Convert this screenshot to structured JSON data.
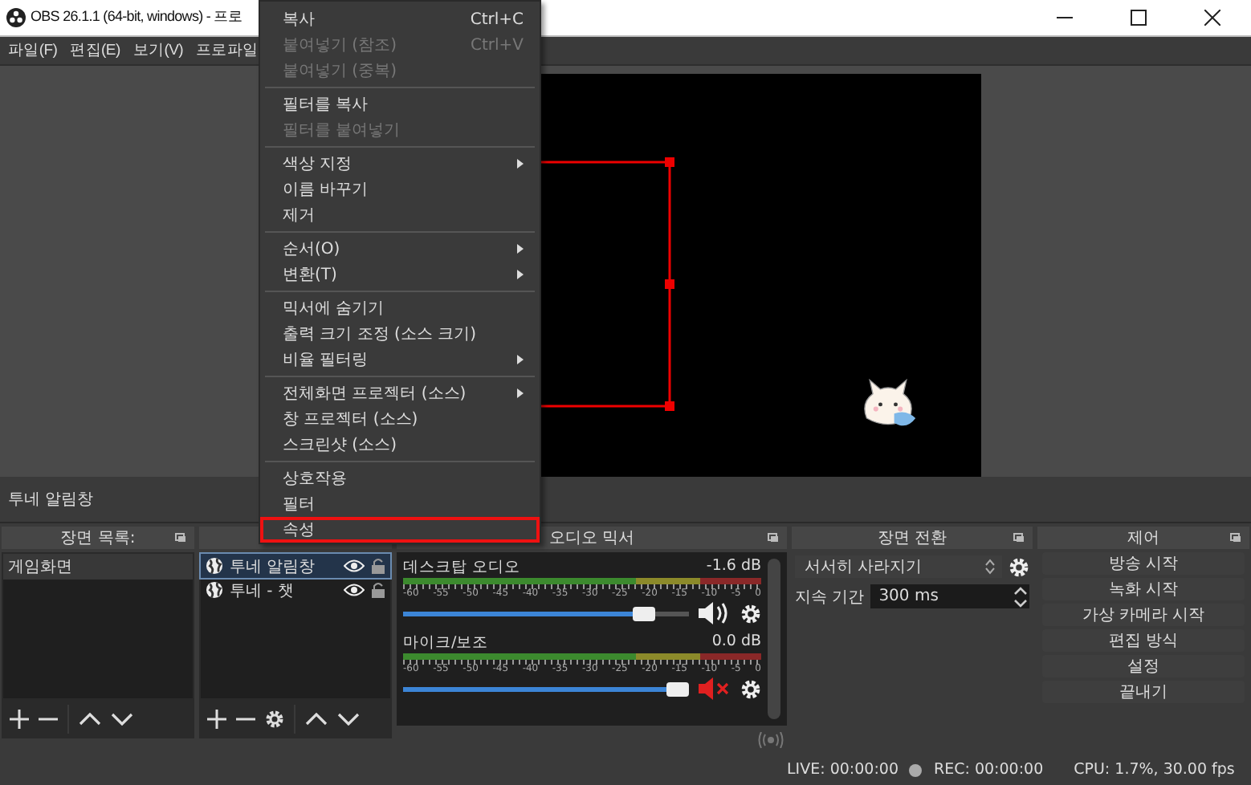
{
  "window": {
    "title": "OBS 26.1.1 (64-bit, windows) - 프로"
  },
  "menu_bar": [
    "파일(F)",
    "편집(E)",
    "보기(V)",
    "프로파일"
  ],
  "context_menu": [
    {
      "kind": "item",
      "label": "복사",
      "shortcut": "Ctrl+C",
      "disabled": false,
      "submenu": false,
      "highlighted": false
    },
    {
      "kind": "item",
      "label": "붙여넣기 (참조)",
      "shortcut": "Ctrl+V",
      "disabled": true,
      "submenu": false,
      "highlighted": false
    },
    {
      "kind": "item",
      "label": "붙여넣기 (중복)",
      "disabled": true,
      "submenu": false,
      "highlighted": false
    },
    {
      "kind": "separator"
    },
    {
      "kind": "item",
      "label": "필터를 복사",
      "disabled": false,
      "submenu": false,
      "highlighted": false
    },
    {
      "kind": "item",
      "label": "필터를 붙여넣기",
      "disabled": true,
      "submenu": false,
      "highlighted": false
    },
    {
      "kind": "separator"
    },
    {
      "kind": "item",
      "label": "색상 지정",
      "disabled": false,
      "submenu": true,
      "highlighted": false
    },
    {
      "kind": "item",
      "label": "이름 바꾸기",
      "disabled": false,
      "submenu": false,
      "highlighted": false
    },
    {
      "kind": "item",
      "label": "제거",
      "disabled": false,
      "submenu": false,
      "highlighted": false
    },
    {
      "kind": "separator"
    },
    {
      "kind": "item",
      "label": "순서(O)",
      "disabled": false,
      "submenu": true,
      "highlighted": false
    },
    {
      "kind": "item",
      "label": "변환(T)",
      "disabled": false,
      "submenu": true,
      "highlighted": false
    },
    {
      "kind": "separator"
    },
    {
      "kind": "item",
      "label": "믹서에 숨기기",
      "disabled": false,
      "submenu": false,
      "highlighted": false
    },
    {
      "kind": "item",
      "label": "출력 크기 조정 (소스 크기)",
      "disabled": false,
      "submenu": false,
      "highlighted": false
    },
    {
      "kind": "item",
      "label": "비율 필터링",
      "disabled": false,
      "submenu": true,
      "highlighted": false
    },
    {
      "kind": "separator"
    },
    {
      "kind": "item",
      "label": "전체화면 프로젝터 (소스)",
      "disabled": false,
      "submenu": true,
      "highlighted": false
    },
    {
      "kind": "item",
      "label": "창 프로젝터 (소스)",
      "disabled": false,
      "submenu": false,
      "highlighted": false
    },
    {
      "kind": "item",
      "label": "스크린샷 (소스)",
      "disabled": false,
      "submenu": false,
      "highlighted": false
    },
    {
      "kind": "separator"
    },
    {
      "kind": "item",
      "label": "상호작용",
      "disabled": false,
      "submenu": false,
      "highlighted": false
    },
    {
      "kind": "item",
      "label": "필터",
      "disabled": false,
      "submenu": false,
      "highlighted": false
    },
    {
      "kind": "item",
      "label": "속성",
      "disabled": false,
      "submenu": false,
      "highlighted": true
    }
  ],
  "preview_label": "투네 알림창",
  "scenes": {
    "title": "장면 목록:",
    "items": [
      {
        "label": "게임화면",
        "selected": true
      }
    ]
  },
  "sources": {
    "items": [
      {
        "label": "투네 알림창",
        "selected": true,
        "visible": true,
        "locked": false
      },
      {
        "label": "투네 - 챗",
        "selected": false,
        "visible": true,
        "locked": false
      }
    ]
  },
  "mixer": {
    "title": "오디오 믹서",
    "tracks": [
      {
        "name": "데스크탑 오디오",
        "reading": "-1.6 dB",
        "level": 0.88,
        "muted": false,
        "scale": [
          "-60",
          "-55",
          "-50",
          "-45",
          "-40",
          "-35",
          "-30",
          "-25",
          "-20",
          "-15",
          "-10",
          "-5",
          "0"
        ]
      },
      {
        "name": "마이크/보조",
        "reading": "0.0 dB",
        "level": 1,
        "muted": true,
        "scale": [
          "-60",
          "-55",
          "-50",
          "-45",
          "-40",
          "-35",
          "-30",
          "-25",
          "-20",
          "-15",
          "-10",
          "-5",
          "0"
        ]
      }
    ]
  },
  "transitions": {
    "title": "장면 전환",
    "selected": "서서히 사라지기",
    "duration_label": "지속 기간",
    "duration": "300 ms"
  },
  "controls": {
    "title": "제어",
    "buttons": [
      "방송 시작",
      "녹화 시작",
      "가상 카메라 시작",
      "편집 방식",
      "설정",
      "끝내기"
    ]
  },
  "status_bar": {
    "live": "LIVE: 00:00:00",
    "rec": "REC: 00:00:00",
    "cpu": "CPU: 1.7%, 30.00 fps"
  }
}
